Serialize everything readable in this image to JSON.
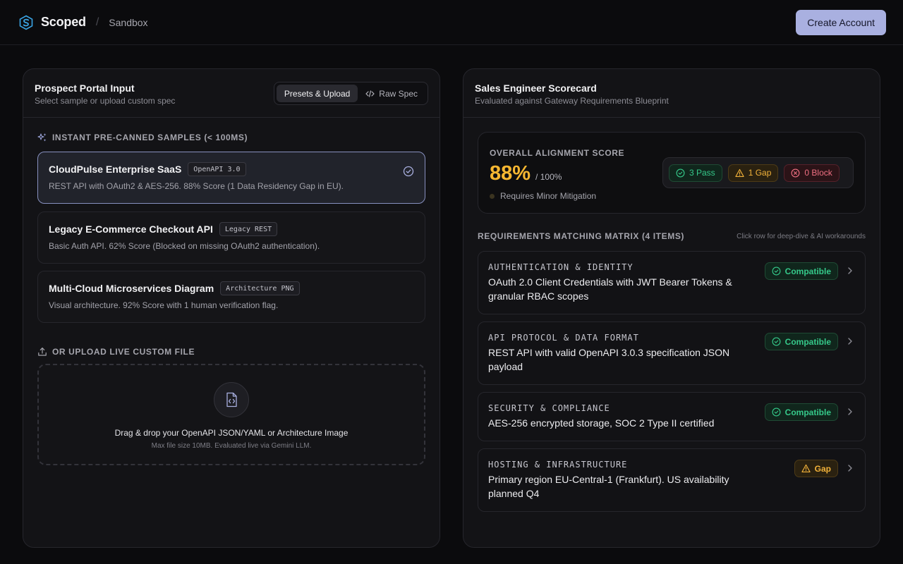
{
  "header": {
    "brand": "Scoped",
    "separator": "/",
    "environment": "Sandbox",
    "create_account": "Create Account"
  },
  "left_panel": {
    "title": "Prospect Portal Input",
    "subtitle": "Select sample or upload custom spec",
    "tabs": [
      {
        "label": "Presets & Upload",
        "active": true
      },
      {
        "label": "Raw Spec",
        "active": false
      }
    ],
    "samples_label": "INSTANT PRE-CANNED SAMPLES (< 100MS)",
    "samples": [
      {
        "title": "CloudPulse Enterprise SaaS",
        "tag": "OpenAPI 3.0",
        "desc": "REST API with OAuth2 & AES-256. 88% Score (1 Data Residency Gap in EU).",
        "selected": true
      },
      {
        "title": "Legacy E-Commerce Checkout API",
        "tag": "Legacy REST",
        "desc": "Basic Auth API. 62% Score (Blocked on missing OAuth2 authentication).",
        "selected": false
      },
      {
        "title": "Multi-Cloud Microservices Diagram",
        "tag": "Architecture PNG",
        "desc": "Visual architecture. 92% Score with 1 human verification flag.",
        "selected": false
      }
    ],
    "upload_label": "OR UPLOAD LIVE CUSTOM FILE",
    "dropzone": {
      "title": "Drag & drop your OpenAPI JSON/YAML or Architecture Image",
      "subtitle": "Max file size 10MB. Evaluated live via Gemini LLM."
    }
  },
  "right_panel": {
    "title": "Sales Engineer Scorecard",
    "subtitle": "Evaluated against Gateway Requirements Blueprint",
    "score": {
      "label": "OVERALL ALIGNMENT SCORE",
      "value": "88%",
      "total": "/ 100%",
      "status": "Requires Minor Mitigation",
      "badges": {
        "pass": "3 Pass",
        "gap": "1 Gap",
        "block": "0 Block"
      }
    },
    "matrix": {
      "title": "REQUIREMENTS MATCHING MATRIX (4 ITEMS)",
      "hint": "Click row for deep-dive & AI workarounds",
      "rows": [
        {
          "category": "AUTHENTICATION & IDENTITY",
          "desc": "OAuth 2.0 Client Credentials with JWT Bearer Tokens & granular RBAC scopes",
          "status": "Compatible"
        },
        {
          "category": "API PROTOCOL & DATA FORMAT",
          "desc": "REST API with valid OpenAPI 3.0.3 specification JSON payload",
          "status": "Compatible"
        },
        {
          "category": "SECURITY & COMPLIANCE",
          "desc": "AES-256 encrypted storage, SOC 2 Type II certified",
          "status": "Compatible"
        },
        {
          "category": "HOSTING & INFRASTRUCTURE",
          "desc": "Primary region EU-Central-1 (Frankfurt). US availability planned Q4",
          "status": "Gap"
        }
      ]
    }
  },
  "colors": {
    "accent": "#a9b0e0",
    "score": "#f7b731",
    "pass": "#35c98a",
    "gap": "#f2b23a",
    "block": "#f07082"
  }
}
